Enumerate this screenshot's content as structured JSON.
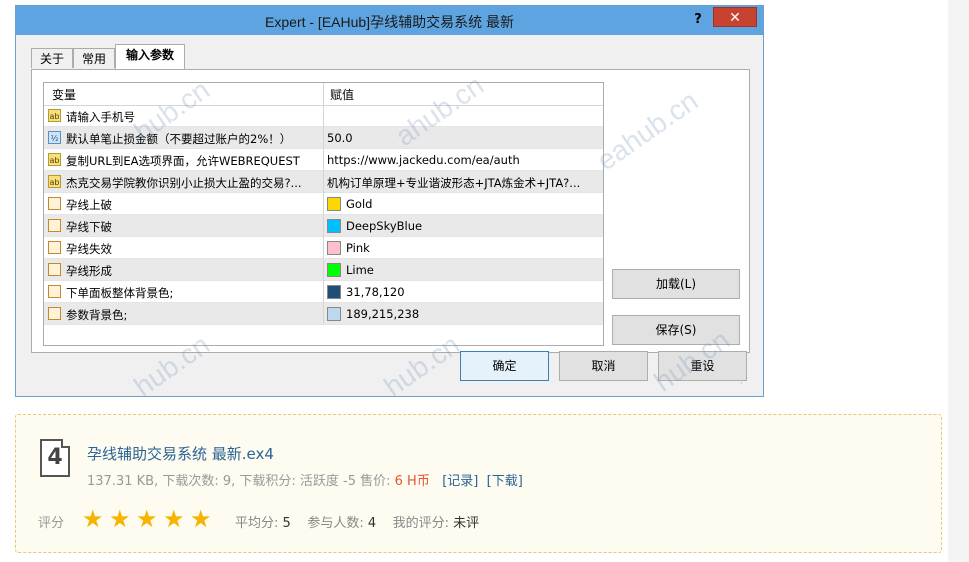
{
  "dialog": {
    "title": "Expert - [EAHub]孕线辅助交易系统 最新",
    "help": "?",
    "close": "✕",
    "tabs": [
      "关于",
      "常用",
      "输入参数"
    ],
    "grid": {
      "col_variable": "变量",
      "col_value": "赋值",
      "rows": [
        {
          "icon": "ab",
          "name": "请输入手机号",
          "value": ""
        },
        {
          "icon": "½",
          "name": "默认单笔止损金额（不要超过账户的2%！）",
          "value": "50.0"
        },
        {
          "icon": "ab",
          "name": "复制URL到EA选项界面，允许WEBREQUEST",
          "value": "https://www.jackedu.com/ea/auth"
        },
        {
          "icon": "ab",
          "name": "杰克交易学院教你识别小止损大止盈的交易?...",
          "value": "机构订单原理+专业谐波形态+JTA炼金术+JTA?..."
        },
        {
          "icon": "clr",
          "name": "孕线上破",
          "value": "Gold",
          "swatch": "#ffd700"
        },
        {
          "icon": "clr",
          "name": "孕线下破",
          "value": "DeepSkyBlue",
          "swatch": "#00bfff"
        },
        {
          "icon": "clr",
          "name": "孕线失效",
          "value": "Pink",
          "swatch": "#ffc0cb"
        },
        {
          "icon": "clr",
          "name": "孕线形成",
          "value": "Lime",
          "swatch": "#00ff00"
        },
        {
          "icon": "clr",
          "name": "下单面板整体背景色;",
          "value": "31,78,120",
          "swatch": "#1f4e78"
        },
        {
          "icon": "clr",
          "name": "参数背景色;",
          "value": "189,215,238",
          "swatch": "#bdd7ee"
        }
      ]
    },
    "buttons": {
      "load": "加载(L)",
      "save": "保存(S)",
      "ok": "确定",
      "cancel": "取消",
      "reset": "重设"
    }
  },
  "download": {
    "file_icon_number": "4",
    "file_name": "孕线辅助交易系统 最新.ex4",
    "meta_prefix": "137.31 KB, 下载次数: 9, 下载积分: 活跃度 -5 售价: ",
    "price": "6 H币",
    "record_link": "[记录]",
    "download_link": "[下载]",
    "rating_label": "评分",
    "stars": 5,
    "avg_label": "平均分: ",
    "avg_value": "5",
    "count_label": "参与人数: ",
    "count_value": "4",
    "my_label": "我的评分: ",
    "my_value": "未评"
  }
}
